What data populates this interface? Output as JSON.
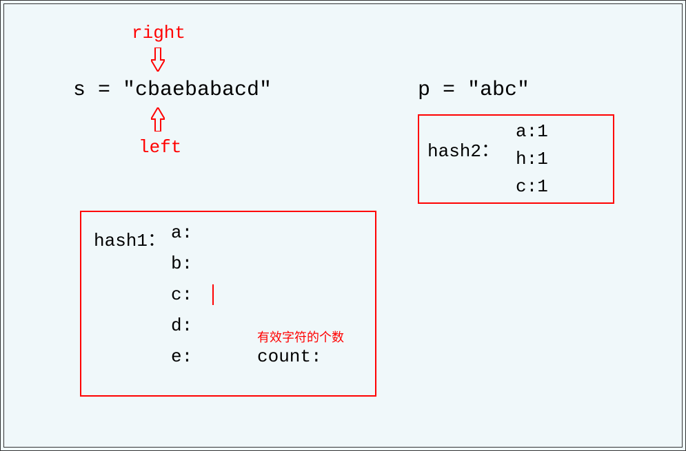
{
  "diagram": {
    "right_label": "right",
    "left_label": "left",
    "s_expr": "s = \"cbaebabacd\"",
    "p_expr": "p = \"abc\"",
    "hash1": {
      "label": "hash1：",
      "entries": [
        "a:",
        "b:",
        "c:",
        "d:",
        "e:"
      ]
    },
    "hash2": {
      "label": "hash2：",
      "entries": [
        "a:1",
        "h:1",
        "c:1"
      ]
    },
    "count_note": "有效字符的个数",
    "count_label": "count:"
  }
}
